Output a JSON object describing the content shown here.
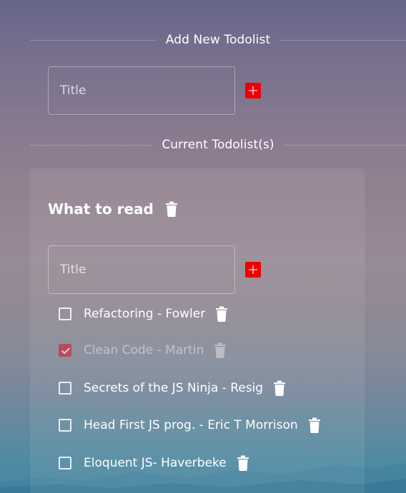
{
  "add_section": {
    "heading": "Add New Todolist",
    "input_placeholder": "Title"
  },
  "current_section": {
    "heading": "Current Todolist(s)"
  },
  "todolist": {
    "title": "What to read",
    "input_placeholder": "Title",
    "items": [
      {
        "text": "Refactoring - Fowler",
        "done": false
      },
      {
        "text": "Clean Code - Martin",
        "done": true
      },
      {
        "text": "Secrets of the JS Ninja - Resig",
        "done": false
      },
      {
        "text": "Head First JS prog. - Eric T Morrison",
        "done": false
      },
      {
        "text": "Eloquent JS- Haverbeke",
        "done": false
      }
    ]
  },
  "icons": {
    "add": "plus-icon",
    "delete": "trash-icon"
  },
  "colors": {
    "add_button": "#ee0000",
    "checked_box": "#b44d5c"
  }
}
